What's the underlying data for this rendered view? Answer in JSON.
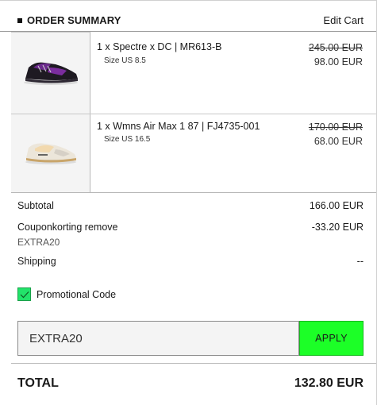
{
  "header": {
    "title": "ORDER SUMMARY",
    "edit_cart": "Edit Cart"
  },
  "items": [
    {
      "name": "1 x Spectre x DC | MR613-B",
      "size": "Size US 8.5",
      "old_price": "245.00 EUR",
      "new_price": "98.00 EUR",
      "image_icon": "purple-black-sneaker"
    },
    {
      "name": "1 x Wmns Air Max 1 87 | FJ4735-001",
      "size": "Size US 16.5",
      "old_price": "170.00 EUR",
      "new_price": "68.00 EUR",
      "image_icon": "cream-white-sneaker"
    }
  ],
  "summary": {
    "subtotal_label": "Subtotal",
    "subtotal_value": "166.00 EUR",
    "coupon_label": "Couponkorting",
    "coupon_remove": "remove",
    "coupon_code": "EXTRA20",
    "coupon_value": "-33.20 EUR",
    "shipping_label": "Shipping",
    "shipping_value": "--"
  },
  "promo": {
    "label": "Promotional Code",
    "checked": true,
    "input_value": "EXTRA20",
    "apply_label": "APPLY"
  },
  "total": {
    "label": "TOTAL",
    "value": "132.80 EUR"
  },
  "colors": {
    "apply_green": "#1cff27",
    "checkbox_green": "#22e36a"
  }
}
